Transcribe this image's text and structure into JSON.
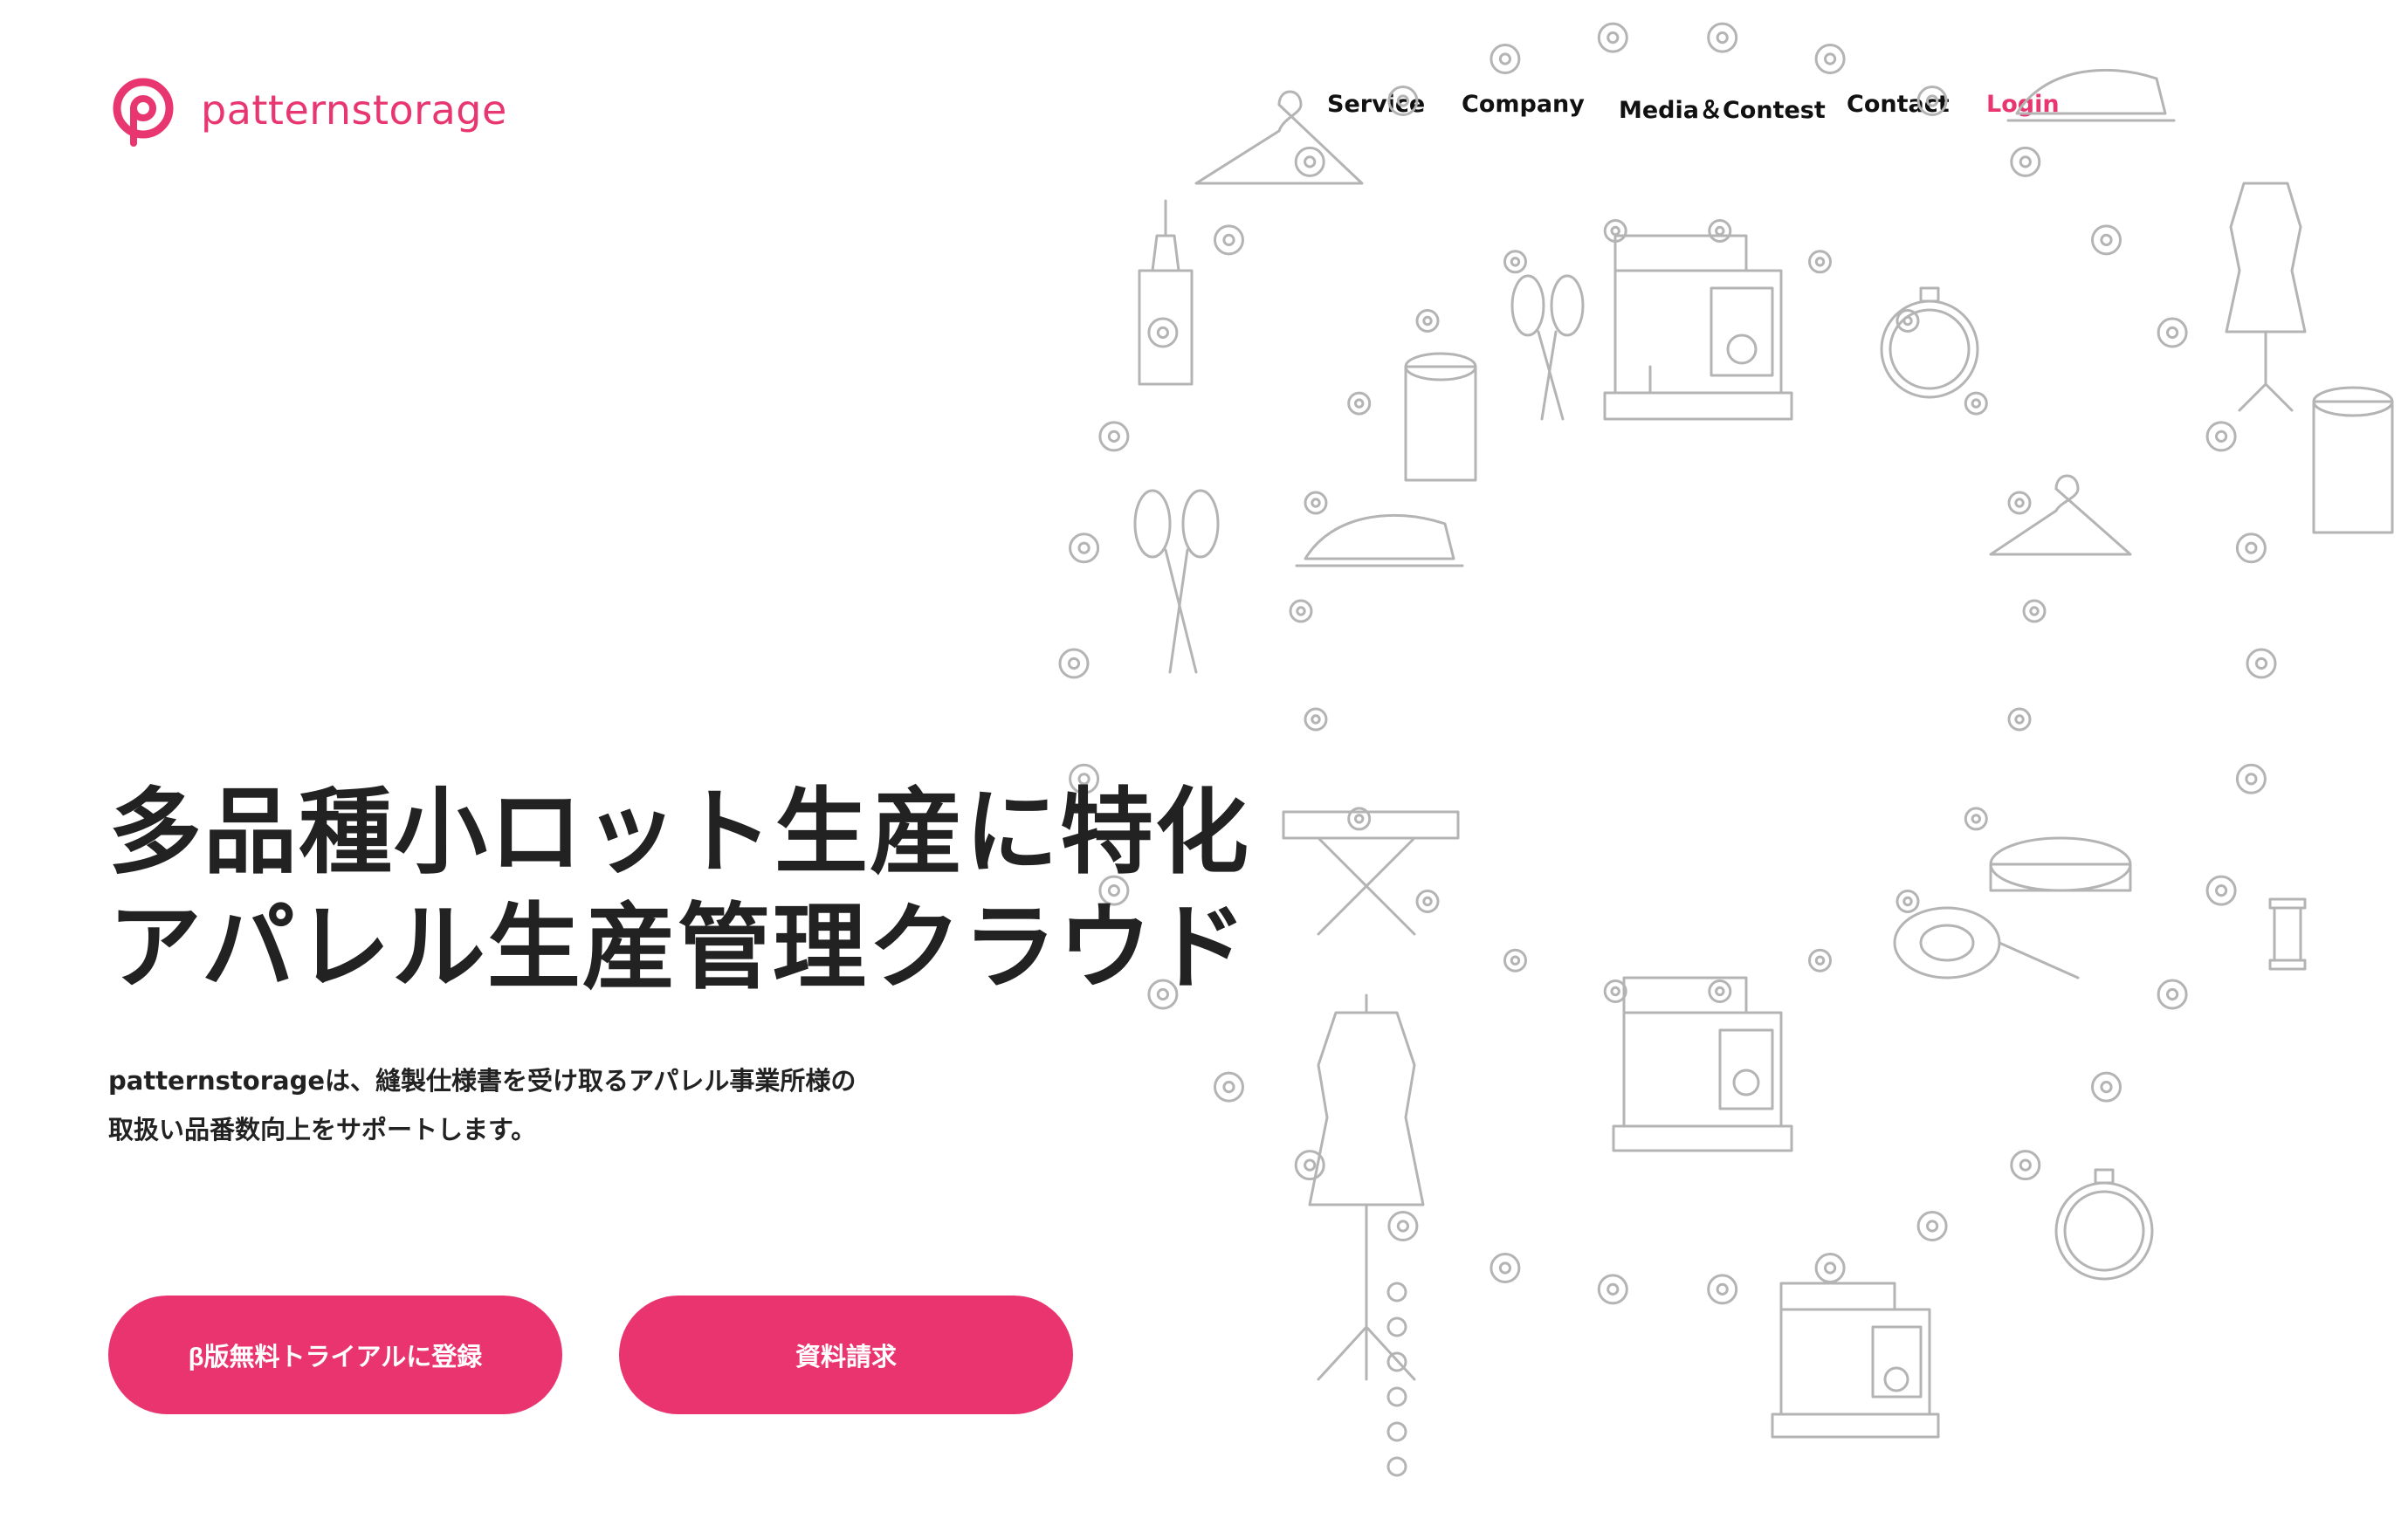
{
  "brand": {
    "name": "patternstorage",
    "logo_icon": "p-logo-icon",
    "color": "#e83670"
  },
  "nav": {
    "items": [
      {
        "label": "Service"
      },
      {
        "label": "Company"
      },
      {
        "label": "Media＆Contest"
      },
      {
        "label": "Contact"
      },
      {
        "label": "Login"
      }
    ]
  },
  "hero": {
    "title_line1": "多品種小ロット生産に特化",
    "title_line2": "アパレル生産管理クラウド",
    "desc_line1": "patternstorageは、縫製仕様書を受け取るアパレル事業所様の",
    "desc_line2": "取扱い品番数向上をサポートします。"
  },
  "cta": {
    "trial_label": "β版無料トライアルに登録",
    "docs_label": "資料請求",
    "button_color": "#ea3470"
  },
  "illustration": {
    "name": "sewing-tools-illustration",
    "stroke_color": "#b4b4b4"
  }
}
